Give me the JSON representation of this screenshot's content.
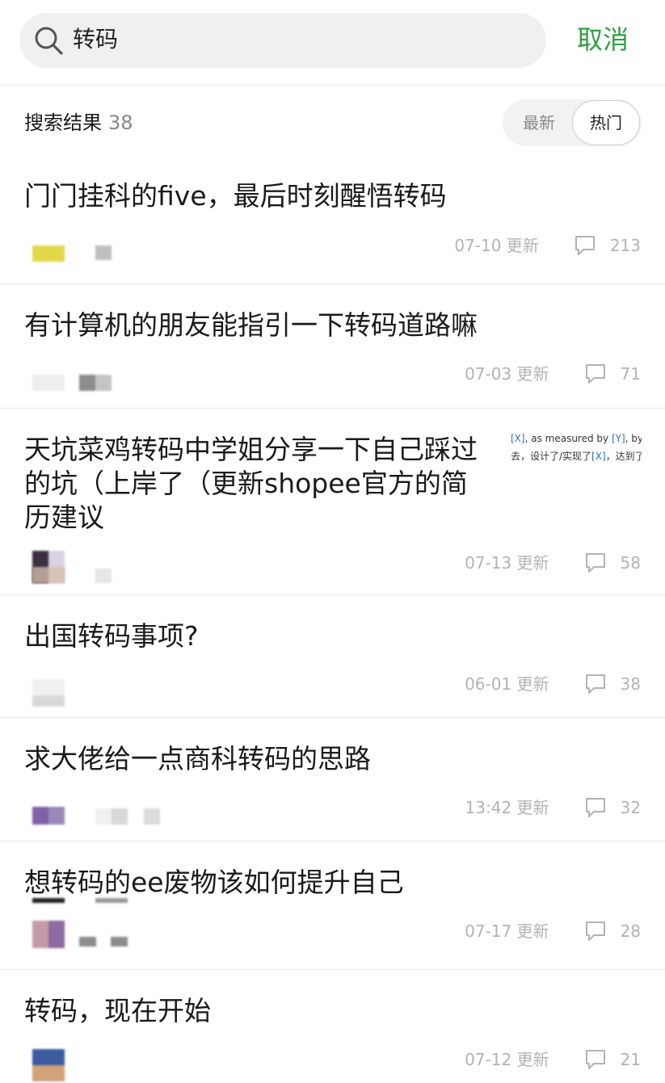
{
  "search": {
    "query": "转码",
    "cancel_label": "取消"
  },
  "results": {
    "label": "搜索结果",
    "count": "38",
    "sort_options": [
      "最新",
      "热门"
    ],
    "active_sort": "热门"
  },
  "posts": [
    {
      "title": "门门挂科的five，最后时刻醒悟转码",
      "date": "07-10 更新",
      "comments": "213"
    },
    {
      "title": "有计算机的朋友能指引一下转码道路嘛",
      "date": "07-03 更新",
      "comments": "71"
    },
    {
      "title": "天坑菜鸡转码中学姐分享一下自己踩过的坑（上岸了（更新shopee官方的简历建议",
      "date": "07-13 更新",
      "comments": "58",
      "thumbnail": {
        "line1_a": "[X]",
        "line1_b": ", as measured by ",
        "line1_c": "[Y]",
        "line1_d": ", by",
        "line2_a": "去，设计了/实现了",
        "line2_b": "[X]",
        "line2_c": "，达到了"
      }
    },
    {
      "title": "出国转码事项?",
      "date": "06-01 更新",
      "comments": "38"
    },
    {
      "title": "求大佬给一点商科转码的思路",
      "date": "13:42 更新",
      "comments": "32"
    },
    {
      "title": "想转码的ee废物该如何提升自己",
      "date": "07-17 更新",
      "comments": "28"
    },
    {
      "title": "转码，现在开始",
      "date": "07-12 更新",
      "comments": "21"
    }
  ],
  "colors": {
    "accent_green": "#2f9e44",
    "meta_gray": "#b3b3b3",
    "divider": "#e6e6e6"
  },
  "icons": {
    "search": "search-icon",
    "comment": "comment-bubble-icon"
  }
}
